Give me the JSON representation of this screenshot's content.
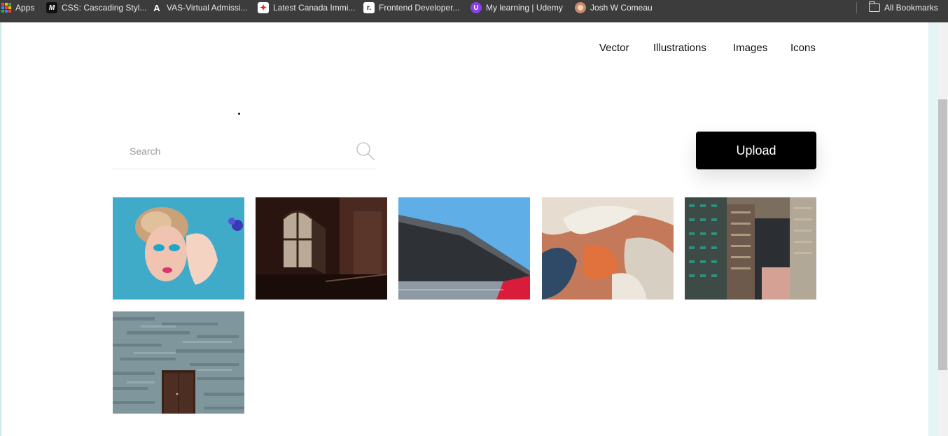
{
  "bookmarks_bar": {
    "items": [
      {
        "label": "Apps",
        "icon": "apps-grid-icon"
      },
      {
        "label": "CSS: Cascading Styl...",
        "icon": "letter-m-icon"
      },
      {
        "label": "VAS-Virtual Admissi...",
        "icon": "letter-a-icon"
      },
      {
        "label": "Latest Canada Immi...",
        "icon": "maple-leaf-icon"
      },
      {
        "label": "Frontend Developer...",
        "icon": "letter-r-icon"
      },
      {
        "label": "My learning | Udemy",
        "icon": "udemy-icon"
      },
      {
        "label": "Josh W Comeau",
        "icon": "avatar-icon"
      }
    ],
    "all_bookmarks": {
      "label": "All Bookmarks",
      "icon": "folder-icon"
    }
  },
  "nav": {
    "items": [
      {
        "label": "Vector"
      },
      {
        "label": "Illustrations"
      },
      {
        "label": "Images"
      },
      {
        "label": "Icons"
      }
    ]
  },
  "search": {
    "placeholder": "Search",
    "value": "",
    "icon": "search-icon"
  },
  "upload": {
    "label": "Upload"
  },
  "gallery": {
    "images": [
      {
        "subject": "woman with blue eye makeup"
      },
      {
        "subject": "dark room with arched window"
      },
      {
        "subject": "angular building roof against blue sky"
      },
      {
        "subject": "aerial view of orange and white terrain"
      },
      {
        "subject": "dense high-rise apartment towers"
      },
      {
        "subject": "stone wall with wooden door"
      }
    ]
  },
  "colors": {
    "bookmarks_bar": "#3c3c3c",
    "upload_button": "#000000",
    "background": "#ffffff"
  }
}
